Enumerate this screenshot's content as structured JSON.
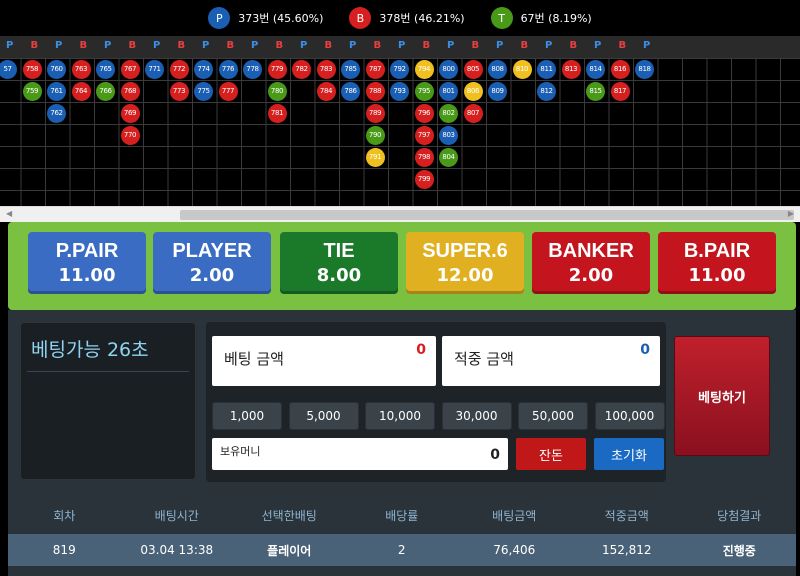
{
  "colors": {
    "player": "#1a5fb4",
    "banker": "#d62020",
    "tie": "#4a9a1a",
    "super6": "#f0c020"
  },
  "stats": [
    {
      "letter": "P",
      "text": "373번 (45.60%)",
      "color": "#1a5fb4"
    },
    {
      "letter": "B",
      "text": "378번 (46.21%)",
      "color": "#d62020"
    },
    {
      "letter": "T",
      "text": "67번 (8.19%)",
      "color": "#4a9a1a"
    }
  ],
  "road_header": [
    "P",
    "B",
    "P",
    "B",
    "P",
    "B",
    "P",
    "B",
    "P",
    "B",
    "P",
    "B",
    "P",
    "B",
    "P",
    "B",
    "P",
    "B",
    "P",
    "B",
    "P",
    "B",
    "P",
    "B",
    "P",
    "B",
    "P"
  ],
  "beads": [
    [
      "57",
      "P",
      0,
      0
    ],
    [
      "758",
      "B",
      1,
      0
    ],
    [
      "760",
      "P",
      2,
      0
    ],
    [
      "763",
      "B",
      3,
      0
    ],
    [
      "765",
      "P",
      4,
      0
    ],
    [
      "767",
      "B",
      5,
      0
    ],
    [
      "771",
      "P",
      6,
      0
    ],
    [
      "772",
      "B",
      7,
      0
    ],
    [
      "774",
      "P",
      8,
      0
    ],
    [
      "776",
      "P",
      9,
      0
    ],
    [
      "778",
      "P",
      10,
      0
    ],
    [
      "779",
      "B",
      11,
      0
    ],
    [
      "782",
      "B",
      12,
      0
    ],
    [
      "783",
      "B",
      13,
      0
    ],
    [
      "785",
      "P",
      14,
      0
    ],
    [
      "787",
      "B",
      15,
      0
    ],
    [
      "792",
      "P",
      16,
      0
    ],
    [
      "794",
      "Y",
      17,
      0
    ],
    [
      "800",
      "P",
      18,
      0
    ],
    [
      "805",
      "B",
      19,
      0
    ],
    [
      "808",
      "P",
      20,
      0
    ],
    [
      "810",
      "Y",
      21,
      0
    ],
    [
      "811",
      "P",
      22,
      0
    ],
    [
      "813",
      "B",
      23,
      0
    ],
    [
      "814",
      "P",
      24,
      0
    ],
    [
      "816",
      "B",
      25,
      0
    ],
    [
      "818",
      "P",
      26,
      0
    ],
    [
      "759",
      "G",
      1,
      1
    ],
    [
      "761",
      "P",
      2,
      1
    ],
    [
      "764",
      "B",
      3,
      1
    ],
    [
      "766",
      "G",
      4,
      1
    ],
    [
      "768",
      "B",
      5,
      1
    ],
    [
      "773",
      "B",
      7,
      1
    ],
    [
      "775",
      "P",
      8,
      1
    ],
    [
      "777",
      "B",
      9,
      1
    ],
    [
      "780",
      "G",
      11,
      1
    ],
    [
      "784",
      "B",
      13,
      1
    ],
    [
      "786",
      "P",
      14,
      1
    ],
    [
      "788",
      "B",
      15,
      1
    ],
    [
      "793",
      "P",
      16,
      1
    ],
    [
      "795",
      "G",
      17,
      1
    ],
    [
      "801",
      "P",
      18,
      1
    ],
    [
      "806",
      "Y",
      19,
      1
    ],
    [
      "809",
      "P",
      20,
      1
    ],
    [
      "812",
      "P",
      22,
      1
    ],
    [
      "815",
      "G",
      24,
      1
    ],
    [
      "817",
      "B",
      25,
      1
    ],
    [
      "762",
      "P",
      2,
      2
    ],
    [
      "769",
      "B",
      5,
      2
    ],
    [
      "781",
      "B",
      11,
      2
    ],
    [
      "789",
      "B",
      15,
      2
    ],
    [
      "796",
      "B",
      17,
      2
    ],
    [
      "802",
      "G",
      18,
      2
    ],
    [
      "807",
      "B",
      19,
      2
    ],
    [
      "770",
      "B",
      5,
      3
    ],
    [
      "790",
      "G",
      15,
      3
    ],
    [
      "797",
      "B",
      17,
      3
    ],
    [
      "803",
      "P",
      18,
      3
    ],
    [
      "791",
      "Y",
      15,
      4
    ],
    [
      "798",
      "B",
      17,
      4
    ],
    [
      "804",
      "G",
      18,
      4
    ],
    [
      "799",
      "B",
      17,
      5
    ]
  ],
  "scroll": {
    "left": "◀",
    "right": "▶"
  },
  "bet_options": [
    {
      "name": "P.PAIR",
      "odds": "11.00",
      "bg": "#3a6cc4"
    },
    {
      "name": "PLAYER",
      "odds": "2.00",
      "bg": "#3a6cc4"
    },
    {
      "name": "TIE",
      "odds": "8.00",
      "bg": "#1a7a2a"
    },
    {
      "name": "SUPER.6",
      "odds": "12.00",
      "bg": "#e0b020"
    },
    {
      "name": "BANKER",
      "odds": "2.00",
      "bg": "#c4141e"
    },
    {
      "name": "B.PAIR",
      "odds": "11.00",
      "bg": "#c4141e"
    }
  ],
  "timer": "베팅가능 26초",
  "bet_amount": {
    "label": "베팅 금액",
    "value": "0"
  },
  "win_amount": {
    "label": "적중 금액",
    "value": "0"
  },
  "chips": [
    "1,000",
    "5,000",
    "10,000",
    "30,000",
    "50,000",
    "100,000"
  ],
  "wallet": {
    "label": "보유머니",
    "value": "0"
  },
  "change_label": "잔돈",
  "reset_label": "초기화",
  "place_bet_label": "베팅하기",
  "history": {
    "headers": [
      "회차",
      "배팅시간",
      "선택한배팅",
      "배당률",
      "배팅금액",
      "적중금액",
      "당첨결과"
    ],
    "rows": [
      [
        "819",
        "03.04 13:38",
        "플레이어",
        "2",
        "76,406",
        "152,812",
        "진행중"
      ]
    ]
  }
}
